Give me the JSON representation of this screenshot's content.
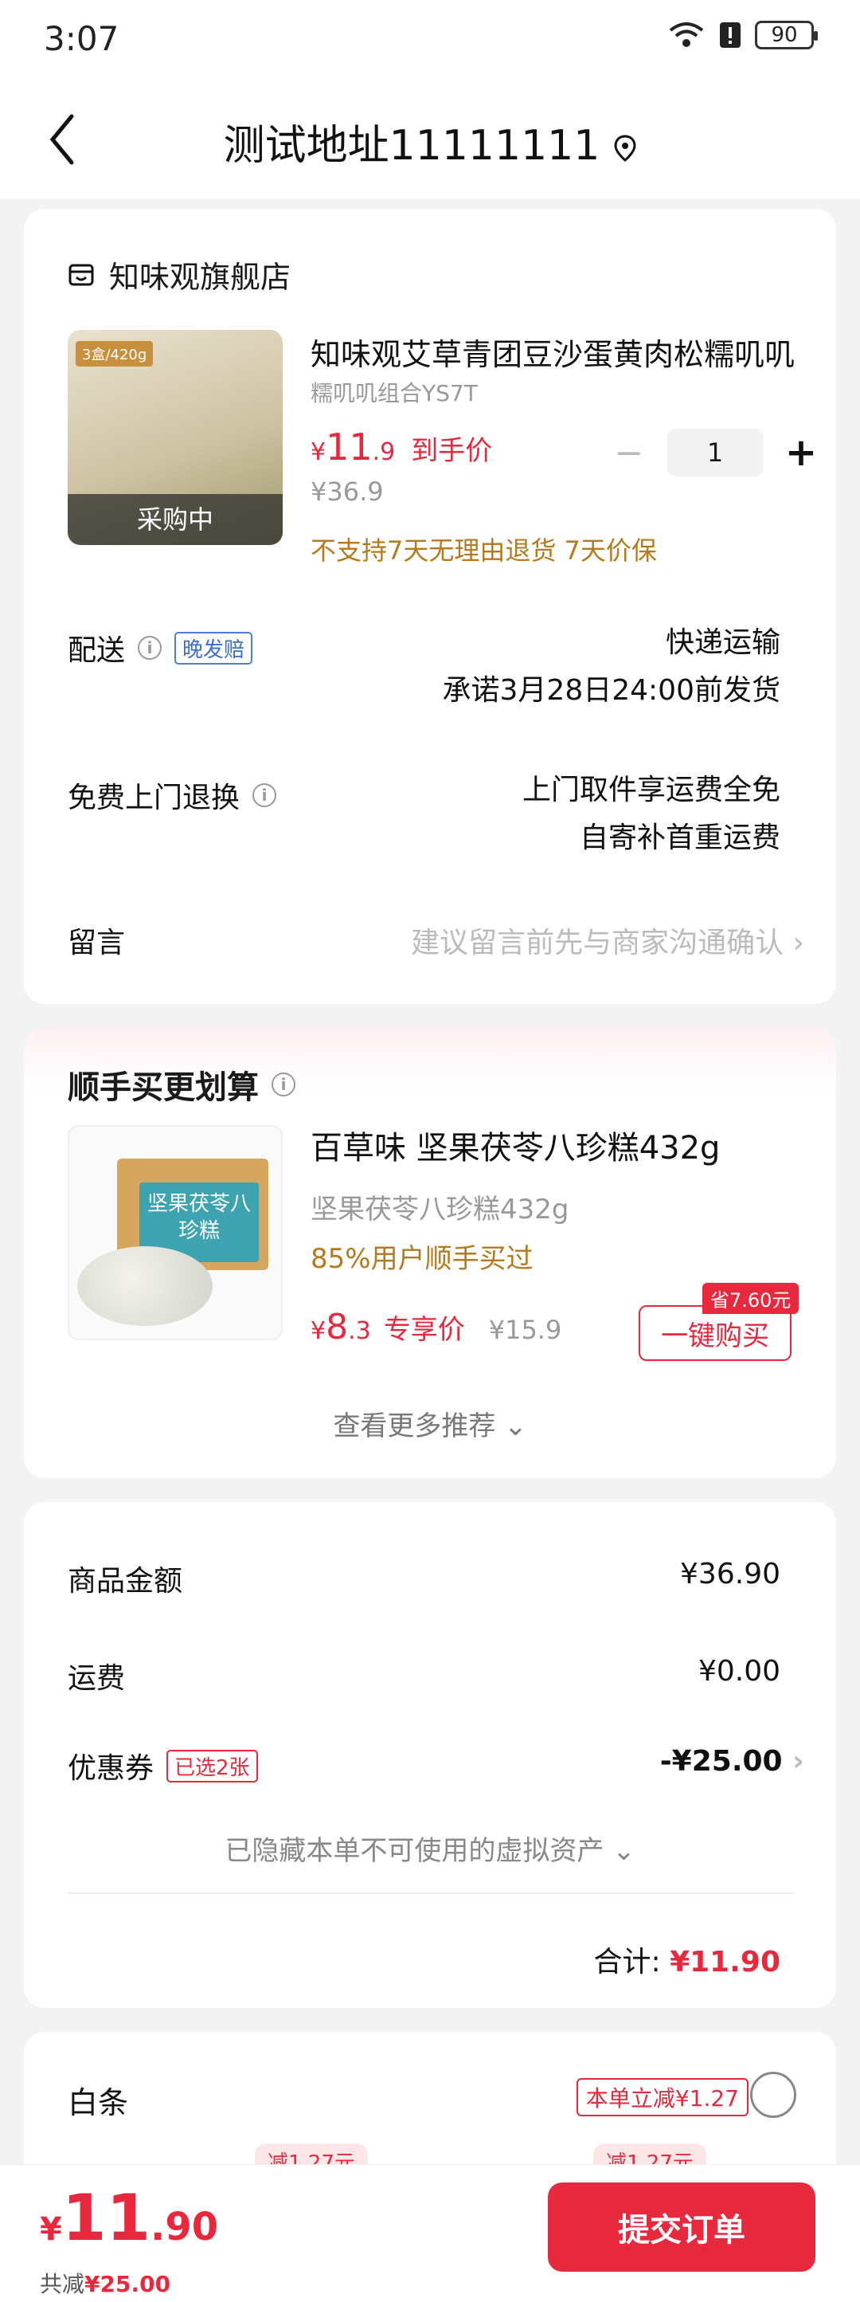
{
  "status": {
    "time": "3:07",
    "battery": "90"
  },
  "nav": {
    "title": "测试地址11111111"
  },
  "shop": {
    "name": "知味观旗舰店"
  },
  "product": {
    "name": "知味观艾草青团豆沙蛋黄肉松糯叽叽",
    "spec": "糯叽叽组合YS7T",
    "image_tag": "3盒/420g",
    "image_caption": "采购中",
    "currency": "¥",
    "price_int": "11",
    "price_dec": ".9",
    "price_label": "到手价",
    "original_price": "¥36.9",
    "quantity": "1",
    "minus": "−",
    "plus": "+",
    "policy": "不支持7天无理由退货  7天价保"
  },
  "delivery": {
    "label": "配送",
    "badge": "晚发赔",
    "method": "快递运输",
    "promise": "承诺3月28日24:00前发货"
  },
  "returns": {
    "label": "免费上门退换",
    "line1": "上门取件享运费全免",
    "line2": "自寄补首重运费"
  },
  "note": {
    "label": "留言",
    "placeholder": "建议留言前先与商家沟通确认"
  },
  "recommend": {
    "title": "顺手买更划算",
    "image_text": "坚果茯苓八珍糕",
    "name": "百草味 坚果茯苓八珍糕432g",
    "spec": "坚果茯苓八珍糕432g",
    "buyers": "85%用户顺手买过",
    "currency": "¥",
    "price_int": "8",
    "price_dec": ".3",
    "price_label": "专享价",
    "original_price": "¥15.9",
    "save_tag": "省7.60元",
    "buy_button": "一键购买",
    "more": "查看更多推荐"
  },
  "summary": {
    "goods_label": "商品金额",
    "goods_value": "¥36.90",
    "shipping_label": "运费",
    "shipping_value": "¥0.00",
    "coupon_label": "优惠券",
    "coupon_badge": "已选2张",
    "coupon_value": "-¥25.00",
    "hidden_note": "已隐藏本单不可使用的虚拟资产",
    "total_label": "合计:",
    "total_value": "¥11.90"
  },
  "payment": {
    "label": "白条",
    "instant": "本单立减¥1.27",
    "pill1": "减1.27元",
    "pill2": "减1.27元"
  },
  "bottom": {
    "currency": "¥",
    "price_int": "11",
    "price_dec": ".90",
    "saved_label": "共减",
    "saved_value": "¥25.00",
    "submit": "提交订单"
  },
  "colors": {
    "accent": "#e8283c",
    "policy": "#b57a1d",
    "background": "#f3f3f3"
  }
}
